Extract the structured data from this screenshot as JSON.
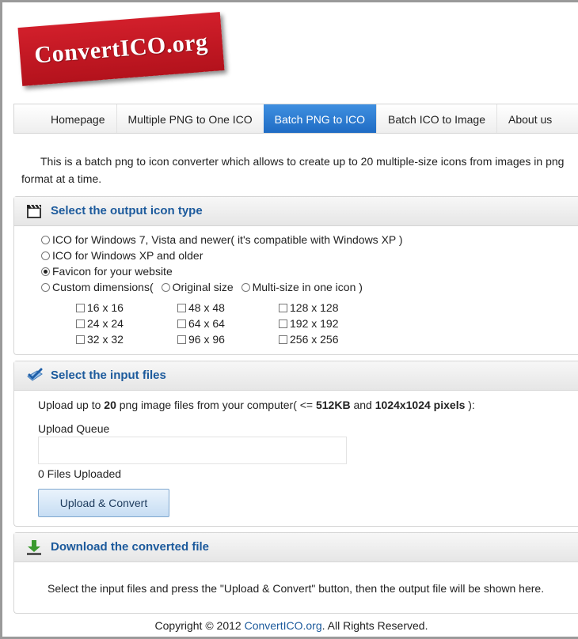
{
  "logo": {
    "text": "ConvertICO.org"
  },
  "nav": [
    {
      "label": "Homepage",
      "active": false
    },
    {
      "label": "Multiple PNG to One ICO",
      "active": false
    },
    {
      "label": "Batch PNG to ICO",
      "active": true
    },
    {
      "label": "Batch ICO to Image",
      "active": false
    },
    {
      "label": "About us",
      "active": false
    }
  ],
  "intro": "This is a batch png to icon converter which allows to create up to 20 multiple-size icons from images in png format at a time.",
  "output_panel": {
    "title": "Select the output icon type",
    "options": [
      {
        "label": "ICO for Windows 7, Vista and newer( it's compatible with Windows XP )",
        "checked": false
      },
      {
        "label": "ICO for Windows XP and older",
        "checked": false
      },
      {
        "label": "Favicon for your website",
        "checked": true
      }
    ],
    "custom": {
      "label": "Custom dimensions(",
      "original": "Original size",
      "multi": "Multi-size in one icon )"
    },
    "sizes": [
      [
        "16 x 16",
        "48 x 48",
        "128 x 128"
      ],
      [
        "24 x 24",
        "64 x 64",
        "192 x 192"
      ],
      [
        "32 x 32",
        "96 x 96",
        "256 x 256"
      ]
    ]
  },
  "input_panel": {
    "title": "Select the input files",
    "upload_text_1": "Upload up to ",
    "upload_count": "20",
    "upload_text_2": " png image files from your computer( <= ",
    "upload_size": "512KB",
    "upload_text_3": " and ",
    "upload_dims": "1024x1024 pixels",
    "upload_text_4": " ):",
    "queue_label": "Upload Queue",
    "uploaded_status": "0 Files Uploaded",
    "button_label": "Upload & Convert"
  },
  "download_panel": {
    "title": "Download the converted file",
    "note": "Select the input files and press the \"Upload & Convert\" button, then the output file will be shown here."
  },
  "footer": {
    "prefix": "Copyright © 2012 ",
    "brand": "ConvertICO.org",
    "suffix": ". All Rights Reserved."
  },
  "colors": {
    "accent": "#1c5a9c",
    "logo_red": "#c4161f",
    "active_tab": "#2e7dd4"
  }
}
